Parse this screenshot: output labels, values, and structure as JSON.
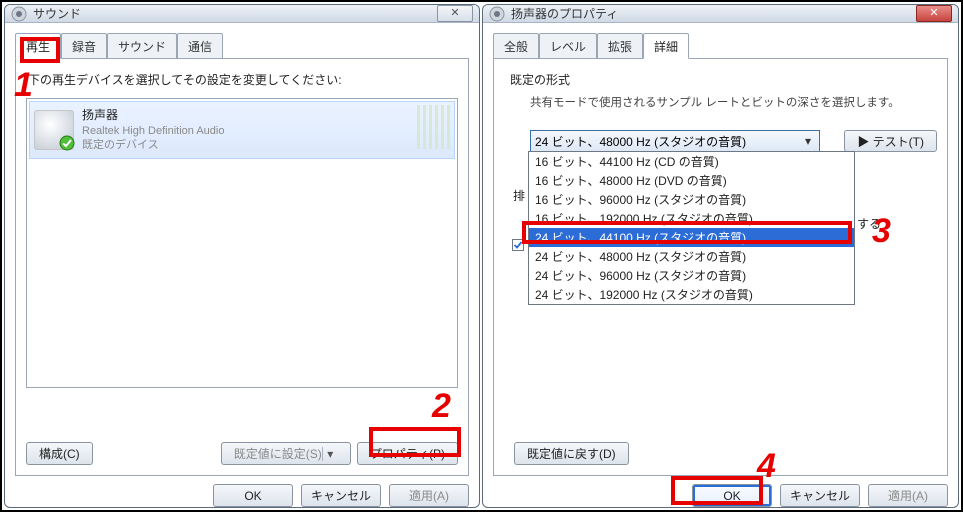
{
  "left": {
    "title": "サウンド",
    "tabs": [
      "再生",
      "録音",
      "サウンド",
      "通信"
    ],
    "instruction": "下の再生デバイスを選択してその設定を変更してください:",
    "device": {
      "name": "扬声器",
      "sub": "Realtek High Definition Audio",
      "default": "既定のデバイス"
    },
    "buttons": {
      "configure": "構成(C)",
      "setdefault": "既定値に設定(S)",
      "properties": "プロパティ(P)"
    },
    "footer": {
      "ok": "OK",
      "cancel": "キャンセル",
      "apply": "適用(A)"
    }
  },
  "right": {
    "title": "扬声器のプロパティ",
    "tabs": [
      "全般",
      "レベル",
      "拡張",
      "詳細"
    ],
    "group_title": "既定の形式",
    "group_sub": "共有モードで使用されるサンプル レートとビットの深さを選択します。",
    "combo_selected": "24 ビット、48000 Hz (スタジオの音質)",
    "test": "▶ テスト(T)",
    "options": [
      "16 ビット、44100 Hz (CD の音質)",
      "16 ビット、48000 Hz (DVD の音質)",
      "16 ビット、96000 Hz (スタジオの音質)",
      "16 ビット、192000 Hz (スタジオの音質)",
      "24 ビット、44100 Hz (スタジオの音質)",
      "24 ビット、48000 Hz (スタジオの音質)",
      "24 ビット、96000 Hz (スタジオの音質)",
      "24 ビット、192000 Hz (スタジオの音質)"
    ],
    "option_selected_index": 4,
    "ex_left": "排",
    "ex_right": "する",
    "reset": "既定値に戻す(D)",
    "footer": {
      "ok": "OK",
      "cancel": "キャンセル",
      "apply": "適用(A)"
    }
  },
  "callouts": {
    "n1": "1",
    "n2": "2",
    "n3": "3",
    "n4": "4"
  }
}
